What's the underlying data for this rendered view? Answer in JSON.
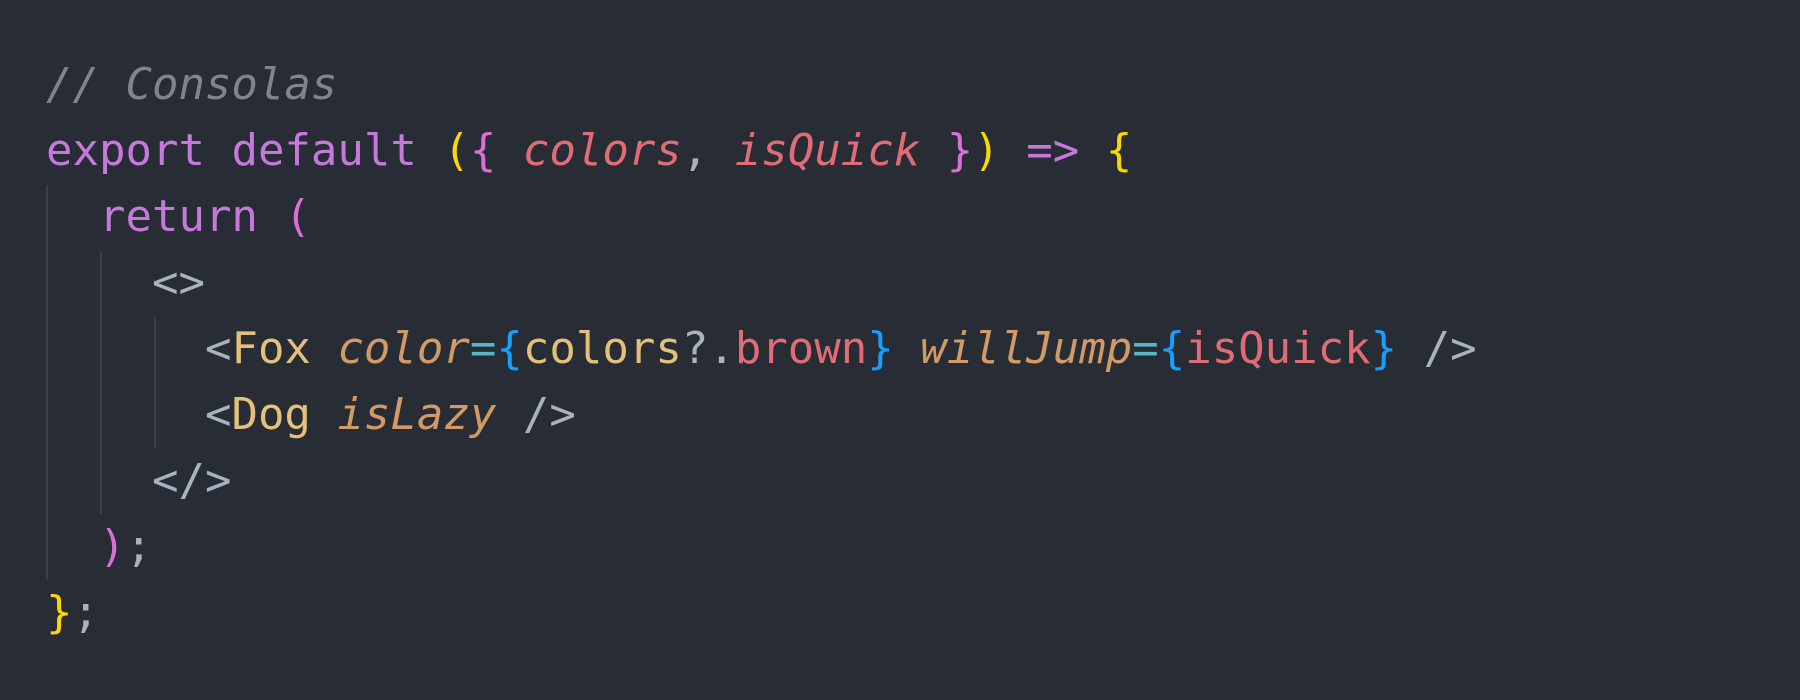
{
  "theme": {
    "background": "#282c34",
    "indent_guide": "#3b4048",
    "keyword": "#c678dd",
    "comment": "#7f848e",
    "parameter": "#e06c75",
    "component": "#e5c07b",
    "attribute": "#d19a66",
    "bracket_yellow": "#ffd700",
    "bracket_pink": "#da70d6",
    "bracket_blue": "#179fff",
    "operator": "#56b6c2"
  },
  "code": {
    "line1": {
      "comment": "// Consolas"
    },
    "line2": {
      "export": "export",
      "default": "default",
      "open_paren": "(",
      "open_brace": "{",
      "param1": "colors",
      "comma": ",",
      "param2": "isQuick",
      "close_brace": "}",
      "close_paren": ")",
      "arrow": "=>",
      "body_brace": "{"
    },
    "line3": {
      "return": "return",
      "open_paren": "("
    },
    "line4": {
      "fragment_open": "<>"
    },
    "line5": {
      "lt": "<",
      "component": "Fox",
      "attr1": "color",
      "eq1": "=",
      "brace_open1": "{",
      "object": "colors",
      "optional": "?.",
      "property": "brown",
      "brace_close1": "}",
      "attr2": "willJump",
      "eq2": "=",
      "brace_open2": "{",
      "value": "isQuick",
      "brace_close2": "}",
      "self_close": "/>"
    },
    "line6": {
      "lt": "<",
      "component": "Dog",
      "attr": "isLazy",
      "self_close": "/>"
    },
    "line7": {
      "fragment_close": "</>"
    },
    "line8": {
      "close_paren": ")",
      "semicolon": ";"
    },
    "line9": {
      "close_brace": "}",
      "semicolon": ";"
    }
  }
}
